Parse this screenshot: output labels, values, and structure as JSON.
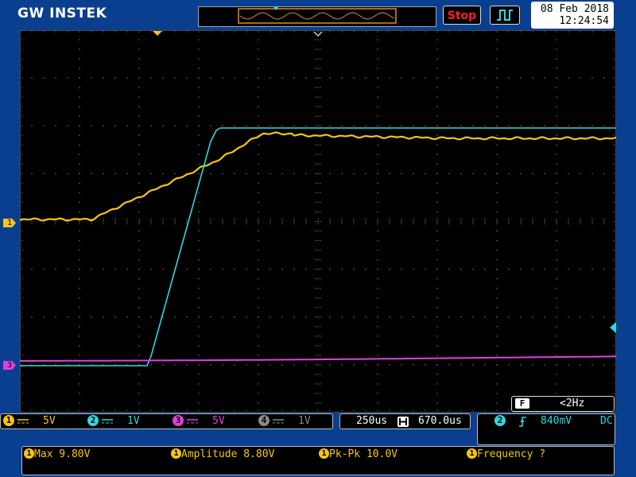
{
  "brand": "GW INSTEK",
  "run_state": "Stop",
  "datetime": {
    "date": "08 Feb 2018",
    "time": "12:24:54"
  },
  "colors": {
    "ch1": "#f5c518",
    "ch2": "#33d6e0",
    "ch3": "#e040e0",
    "ch4": "#8a8a8a",
    "background": "#0a3f8f",
    "stop": "#ff2222"
  },
  "channel_markers": {
    "ch1": "1",
    "ch3": "3"
  },
  "filter": {
    "icon": "F",
    "value": "<2Hz"
  },
  "channels": [
    {
      "num": "1",
      "scale": "5V"
    },
    {
      "num": "2",
      "scale": "1V"
    },
    {
      "num": "3",
      "scale": "5V"
    },
    {
      "num": "4",
      "scale": "1V"
    }
  ],
  "timebase": {
    "scale": "250us",
    "position": "670.0us"
  },
  "trigger": {
    "source": "2",
    "level": "840mV",
    "coupling": "DC",
    "slope_icon": "rising-edge-icon"
  },
  "measurements": [
    {
      "label": "Max 9.80V"
    },
    {
      "label": "Amplitude 8.80V"
    },
    {
      "label": "Pk-Pk 10.0V"
    },
    {
      "label": "Frequency ?"
    }
  ]
}
